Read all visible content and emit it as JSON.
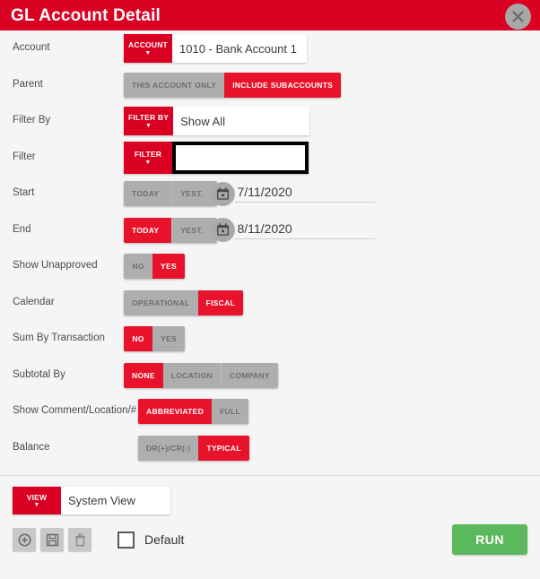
{
  "header": {
    "title": "GL Account Detail",
    "close_label": "×",
    "accent_red": "#da0022"
  },
  "rows": {
    "account": {
      "label": "Account",
      "tag": "ACCOUNT",
      "caret": "▼",
      "value": "1010 - Bank Account 1"
    },
    "parent": {
      "label": "Parent",
      "options": [
        "THIS ACCOUNT ONLY",
        "INCLUDE SUBACCOUNTS"
      ],
      "selected": "INCLUDE SUBACCOUNTS"
    },
    "filter_by": {
      "label": "Filter By",
      "tag": "FILTER BY",
      "caret": "▼",
      "value": "Show All"
    },
    "filter": {
      "label": "Filter",
      "tag": "FILTER",
      "caret": "▼",
      "value": "",
      "focused": true
    },
    "start": {
      "label": "Start",
      "options": [
        "TODAY",
        "YEST."
      ],
      "selected": "",
      "date": "7/11/2020"
    },
    "end": {
      "label": "End",
      "options": [
        "TODAY",
        "YEST."
      ],
      "selected": "TODAY",
      "date": "8/11/2020"
    },
    "show_unapproved": {
      "label": "Show Unapproved",
      "options": [
        "NO",
        "YES"
      ],
      "selected": "YES"
    },
    "calendar": {
      "label": "Calendar",
      "options": [
        "OPERATIONAL",
        "FISCAL"
      ],
      "selected": "FISCAL"
    },
    "sum_by_transaction": {
      "label": "Sum By Transaction",
      "options": [
        "NO",
        "YES"
      ],
      "selected": "NO"
    },
    "subtotal_by": {
      "label": "Subtotal By",
      "options": [
        "NONE",
        "LOCATION",
        "COMPANY"
      ],
      "selected": "NONE"
    },
    "show_comment": {
      "label": "Show Comment/Location/#",
      "options": [
        "ABBREVIATED",
        "FULL"
      ],
      "selected": "ABBREVIATED"
    },
    "balance": {
      "label": "Balance",
      "options": [
        "DR(+)/CR(-)",
        "TYPICAL"
      ],
      "selected": "TYPICAL"
    }
  },
  "footer": {
    "view": {
      "tag": "VIEW",
      "caret": "▼",
      "value": "System View"
    },
    "icons": {
      "add": "add-circle-icon",
      "save": "save-disk-icon",
      "delete": "trash-icon"
    },
    "default_label": "Default",
    "default_checked": false,
    "run_label": "RUN",
    "run_color": "#5cb85c"
  }
}
